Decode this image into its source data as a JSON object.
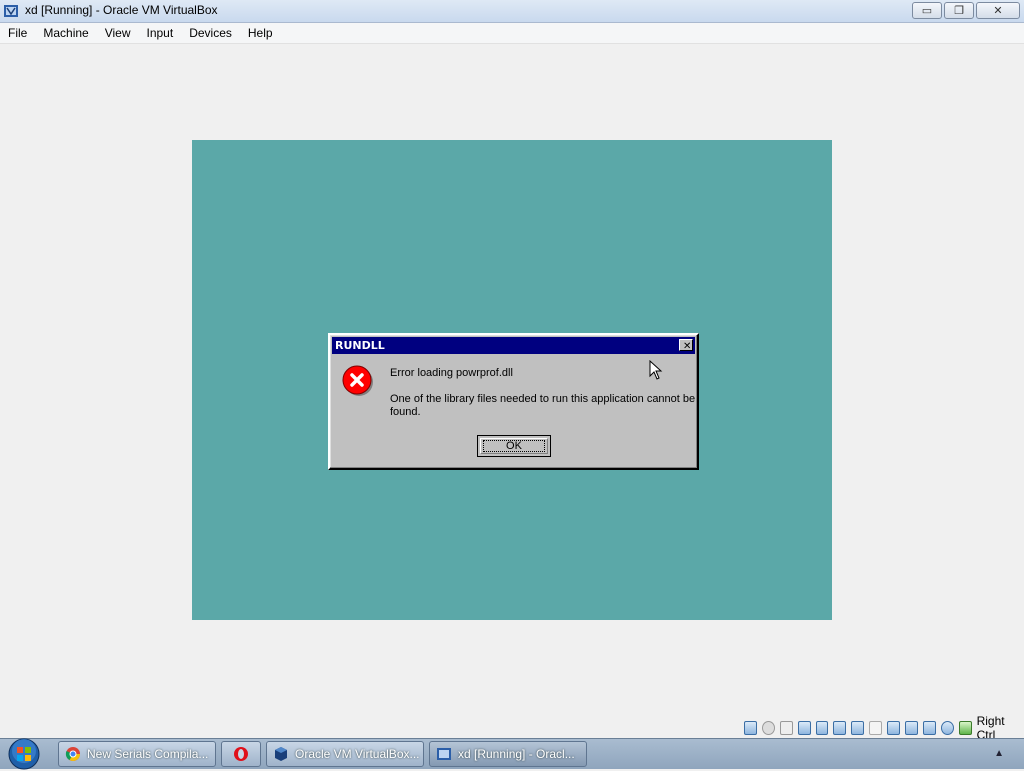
{
  "window": {
    "title": "xd [Running] - Oracle VM VirtualBox",
    "minimize_label": "▭",
    "restore_label": "❐",
    "close_label": "✕"
  },
  "menubar": {
    "items": [
      "File",
      "Machine",
      "View",
      "Input",
      "Devices",
      "Help"
    ]
  },
  "dialog": {
    "title": "RUNDLL",
    "close_label": "✕",
    "message1": "Error loading powrprof.dll",
    "message2_line1": "One of the library files needed to run this application cannot be",
    "message2_line2": "found.",
    "ok_label": "OK"
  },
  "statusbar": {
    "host_key": "Right Ctrl"
  },
  "taskbar": {
    "items": [
      {
        "label": "New Serials Compila..."
      },
      {
        "label": "Oracle VM VirtualBox..."
      },
      {
        "label": "xd [Running] - Oracl..."
      }
    ]
  },
  "colors": {
    "guest_background": "#5ba8a8",
    "dialog_titlebar": "#000080",
    "dialog_face": "#c0c0c0"
  }
}
